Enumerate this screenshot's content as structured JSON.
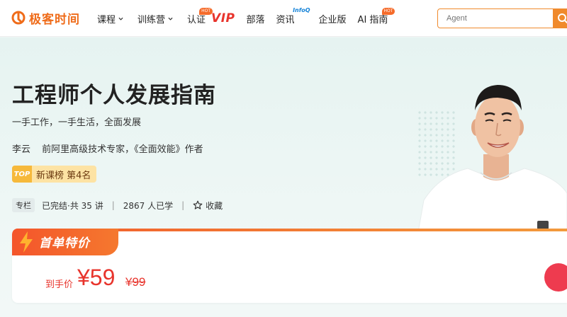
{
  "brand": {
    "name": "极客时间",
    "color": "#ef6c1a"
  },
  "nav": {
    "items": [
      {
        "label": "课程",
        "dropdown": true
      },
      {
        "label": "训练营",
        "dropdown": true
      },
      {
        "label": "认证",
        "badge": "HOT"
      },
      {
        "label": "VIP"
      },
      {
        "label": "部落"
      },
      {
        "label": "资讯",
        "badge": "InfoQ"
      },
      {
        "label": "企业版"
      },
      {
        "label": "AI 指南",
        "badge": "HOT"
      }
    ]
  },
  "search": {
    "placeholder": "Agent"
  },
  "course": {
    "title": "工程师个人发展指南",
    "subtitle": "一手工作，一手生活，全面发展",
    "author_name": "李云",
    "author_desc": "前阿里高级技术专家，《全面效能》作者",
    "rank_icon": "TOP",
    "rank_text": "新课榜 第4名",
    "tag": "专栏",
    "status": "已完结·共 35 讲",
    "learners": "2867 人已学",
    "favorite_label": "收藏"
  },
  "pricing": {
    "promo_label": "首单特价",
    "price_label": "到手价",
    "price": "¥59",
    "original_price": "¥99"
  },
  "colors": {
    "accent": "#f08a2c",
    "price": "#e8342c",
    "promo": "#f4552b",
    "hero_bg": "#e6f3f1"
  }
}
